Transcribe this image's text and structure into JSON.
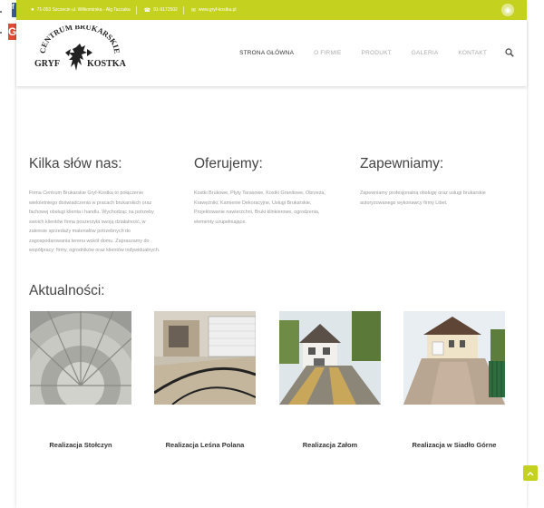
{
  "topbar": {
    "address": "71-053 Szczecin ul. Wiłkomirska - Alg Taczaka",
    "phone": "91-9172502",
    "email": "www.gryf-kostka.pl",
    "accent": "#c5d11f"
  },
  "logo": {
    "line_top": "CENTRUM BRUKARSKIE",
    "left": "GRYF",
    "right": "KOSTKA"
  },
  "nav": {
    "items": [
      {
        "label": "STRONA GŁÓWNA",
        "active": true
      },
      {
        "label": "O FIRMIE",
        "active": false
      },
      {
        "label": "PRODUKT",
        "active": false
      },
      {
        "label": "GALERIA",
        "active": false
      },
      {
        "label": "KONTAKT",
        "active": false
      }
    ],
    "search_icon": "search-icon"
  },
  "columns": [
    {
      "heading": "Kilka słów nas:",
      "text": "Firma Centrum Brukarskie Gryf-Kostka to połączenie wieloletniego doświadczenia w pracach brukarskich oraz fachowej obsługi klienta i handlu. Wychodząc na potrzeby swoich klientów firma poszerzyła swoją działalność, w zakresie sprzedaży materiałów potrzebnych do zagospodarowania terenu wokół domu. Zapraszamy do współpracy: firmy, ogrodników oraz klientów indywidualnych."
    },
    {
      "heading": "Oferujemy:",
      "text": "Kostki Brukowe, Płyty Tarasowe, Kostki Granitowe, Obrzeża, Krawężniki, Kamienie Dekoracyjne, Usługi Brukarskie, Projektowanie nawierzchni, Bruki klinkierowe, ogrodzenia, elementy uzupełniające."
    },
    {
      "heading": "Zapewniamy:",
      "text": "Zapewniamy profesjonalną obsługę oraz usługi brukarskie autoryzowanego wykonawcy firmy Libet."
    }
  ],
  "news": {
    "title": "Aktualności:",
    "items": [
      {
        "caption": "Realizacja Stołczyn"
      },
      {
        "caption": "Realizacja Leśna Polana"
      },
      {
        "caption": "Realizacja Załom"
      },
      {
        "caption": "Realizacja w Siadło Górne"
      }
    ]
  }
}
